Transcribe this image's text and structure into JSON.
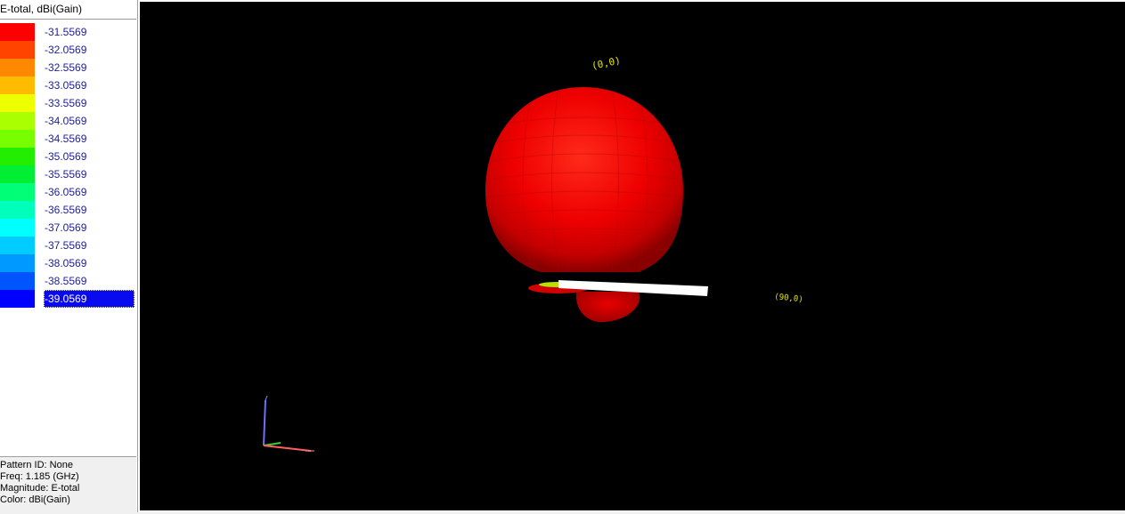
{
  "legend": {
    "title": "E-total, dBi(Gain)",
    "items": [
      {
        "value": "-31.5569",
        "color": "#ff0000"
      },
      {
        "value": "-32.0569",
        "color": "#ff4400"
      },
      {
        "value": "-32.5569",
        "color": "#ff8800"
      },
      {
        "value": "-33.0569",
        "color": "#ffbb00"
      },
      {
        "value": "-33.5569",
        "color": "#eeff00"
      },
      {
        "value": "-34.0569",
        "color": "#aaff00"
      },
      {
        "value": "-34.5569",
        "color": "#77ff00"
      },
      {
        "value": "-35.0569",
        "color": "#22ee00"
      },
      {
        "value": "-35.5569",
        "color": "#00ee33"
      },
      {
        "value": "-36.0569",
        "color": "#00ff77"
      },
      {
        "value": "-36.5569",
        "color": "#00ffbb"
      },
      {
        "value": "-37.0569",
        "color": "#00ffff"
      },
      {
        "value": "-37.5569",
        "color": "#00ccff"
      },
      {
        "value": "-38.0569",
        "color": "#0099ff"
      },
      {
        "value": "-38.5569",
        "color": "#0055ff"
      },
      {
        "value": "-39.0569",
        "color": "#0000ff",
        "selected": true
      }
    ]
  },
  "info": {
    "pattern_id": "Pattern ID: None",
    "freq": "Freq: 1.185 (GHz)",
    "magnitude": "Magnitude: E-total",
    "color": "Color: dBi(Gain)"
  },
  "viewport": {
    "background": "#000000",
    "pattern_color": "#ff0000",
    "axis_label_color": "#e6e600",
    "top_label": "(0,0)",
    "side_label": "(90,0)",
    "triad": {
      "z_color": "#7070ff",
      "y_color": "#40cc40",
      "x_color": "#ff6060"
    }
  }
}
